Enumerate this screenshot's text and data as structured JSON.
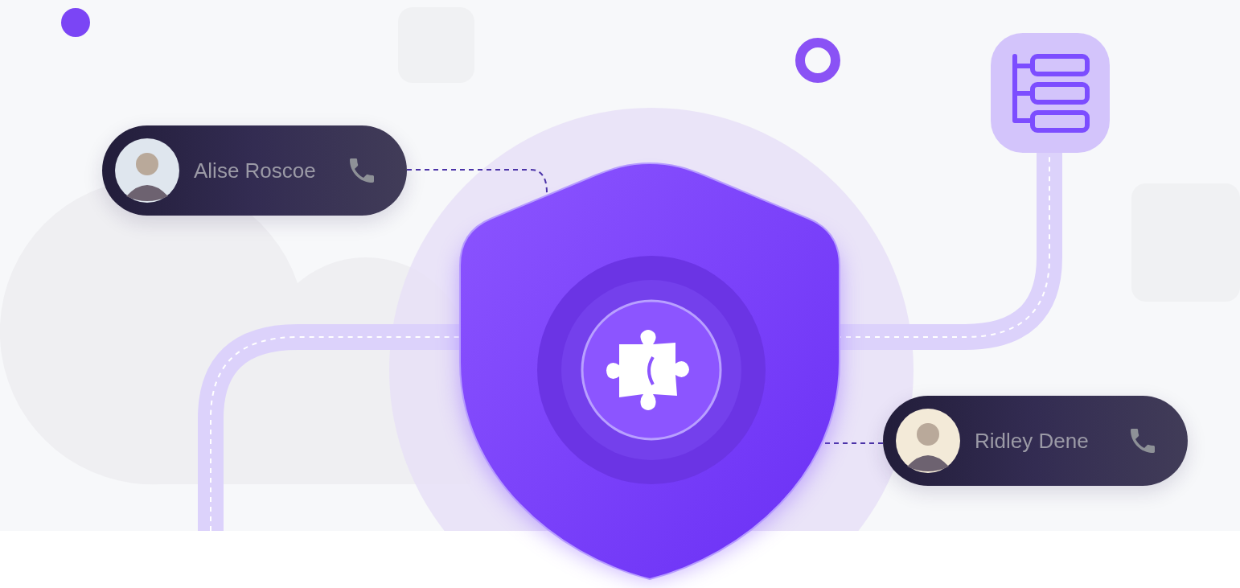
{
  "contacts": [
    {
      "name": "Alise Roscoe"
    },
    {
      "name": "Ridley Dene"
    }
  ]
}
